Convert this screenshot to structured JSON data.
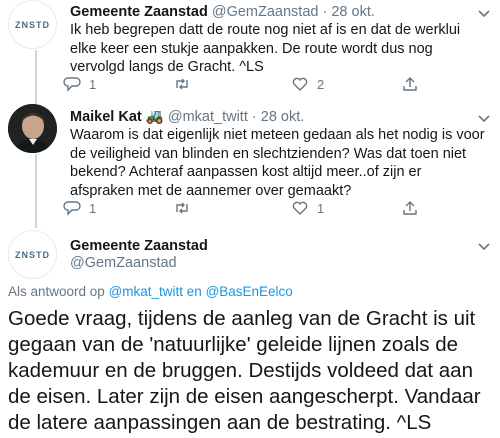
{
  "tweets": [
    {
      "name": "Gemeente Zaanstad",
      "handle": "@GemZaanstad",
      "sep": "·",
      "date": "28 okt.",
      "avatar_text": "ZNSTD",
      "text": "Ik heb begrepen datt de route nog niet af is en dat de werklui elke keer een stukje aanpakken. De route wordt dus nog vervolgd langs de Gracht.  ^LS",
      "reply_count": "1",
      "retweet_count": "",
      "like_count": "2"
    },
    {
      "name": "Maikel Kat",
      "name_emoji": "🚜",
      "handle": "@mkat_twitt",
      "sep": "·",
      "date": "28 okt.",
      "text": "Waarom is dat eigenlijk niet meteen gedaan als het nodig is voor de veiligheid van blinden en slechtzienden? Was dat toen niet bekend? Achteraf aanpassen kost altijd meer..of zijn er afspraken met de aannemer over gemaakt?",
      "reply_count": "1",
      "retweet_count": "",
      "like_count": "1"
    }
  ],
  "main": {
    "name": "Gemeente Zaanstad",
    "handle": "@GemZaanstad",
    "avatar_text": "ZNSTD",
    "reply_prefix": "Als antwoord op",
    "reply_mentions": "@mkat_twitt en @BasEnEelco",
    "text": "Goede vraag, tijdens de aanleg van de Gracht is uit gegaan van de 'natuurlijke' geleide lijnen zoals de kademuur en de bruggen. Destijds voldeed dat aan de eisen. Later zijn de eisen aangescherpt. Vandaar de latere aanpassingen aan de bestrating. ^LS"
  },
  "colors": {
    "text": "#14171a",
    "muted": "#657786",
    "link": "#1b95e0",
    "thread_line": "#ccd6dd"
  },
  "icons": [
    "reply-icon",
    "retweet-icon",
    "like-icon",
    "share-icon",
    "chevron-down-icon"
  ]
}
